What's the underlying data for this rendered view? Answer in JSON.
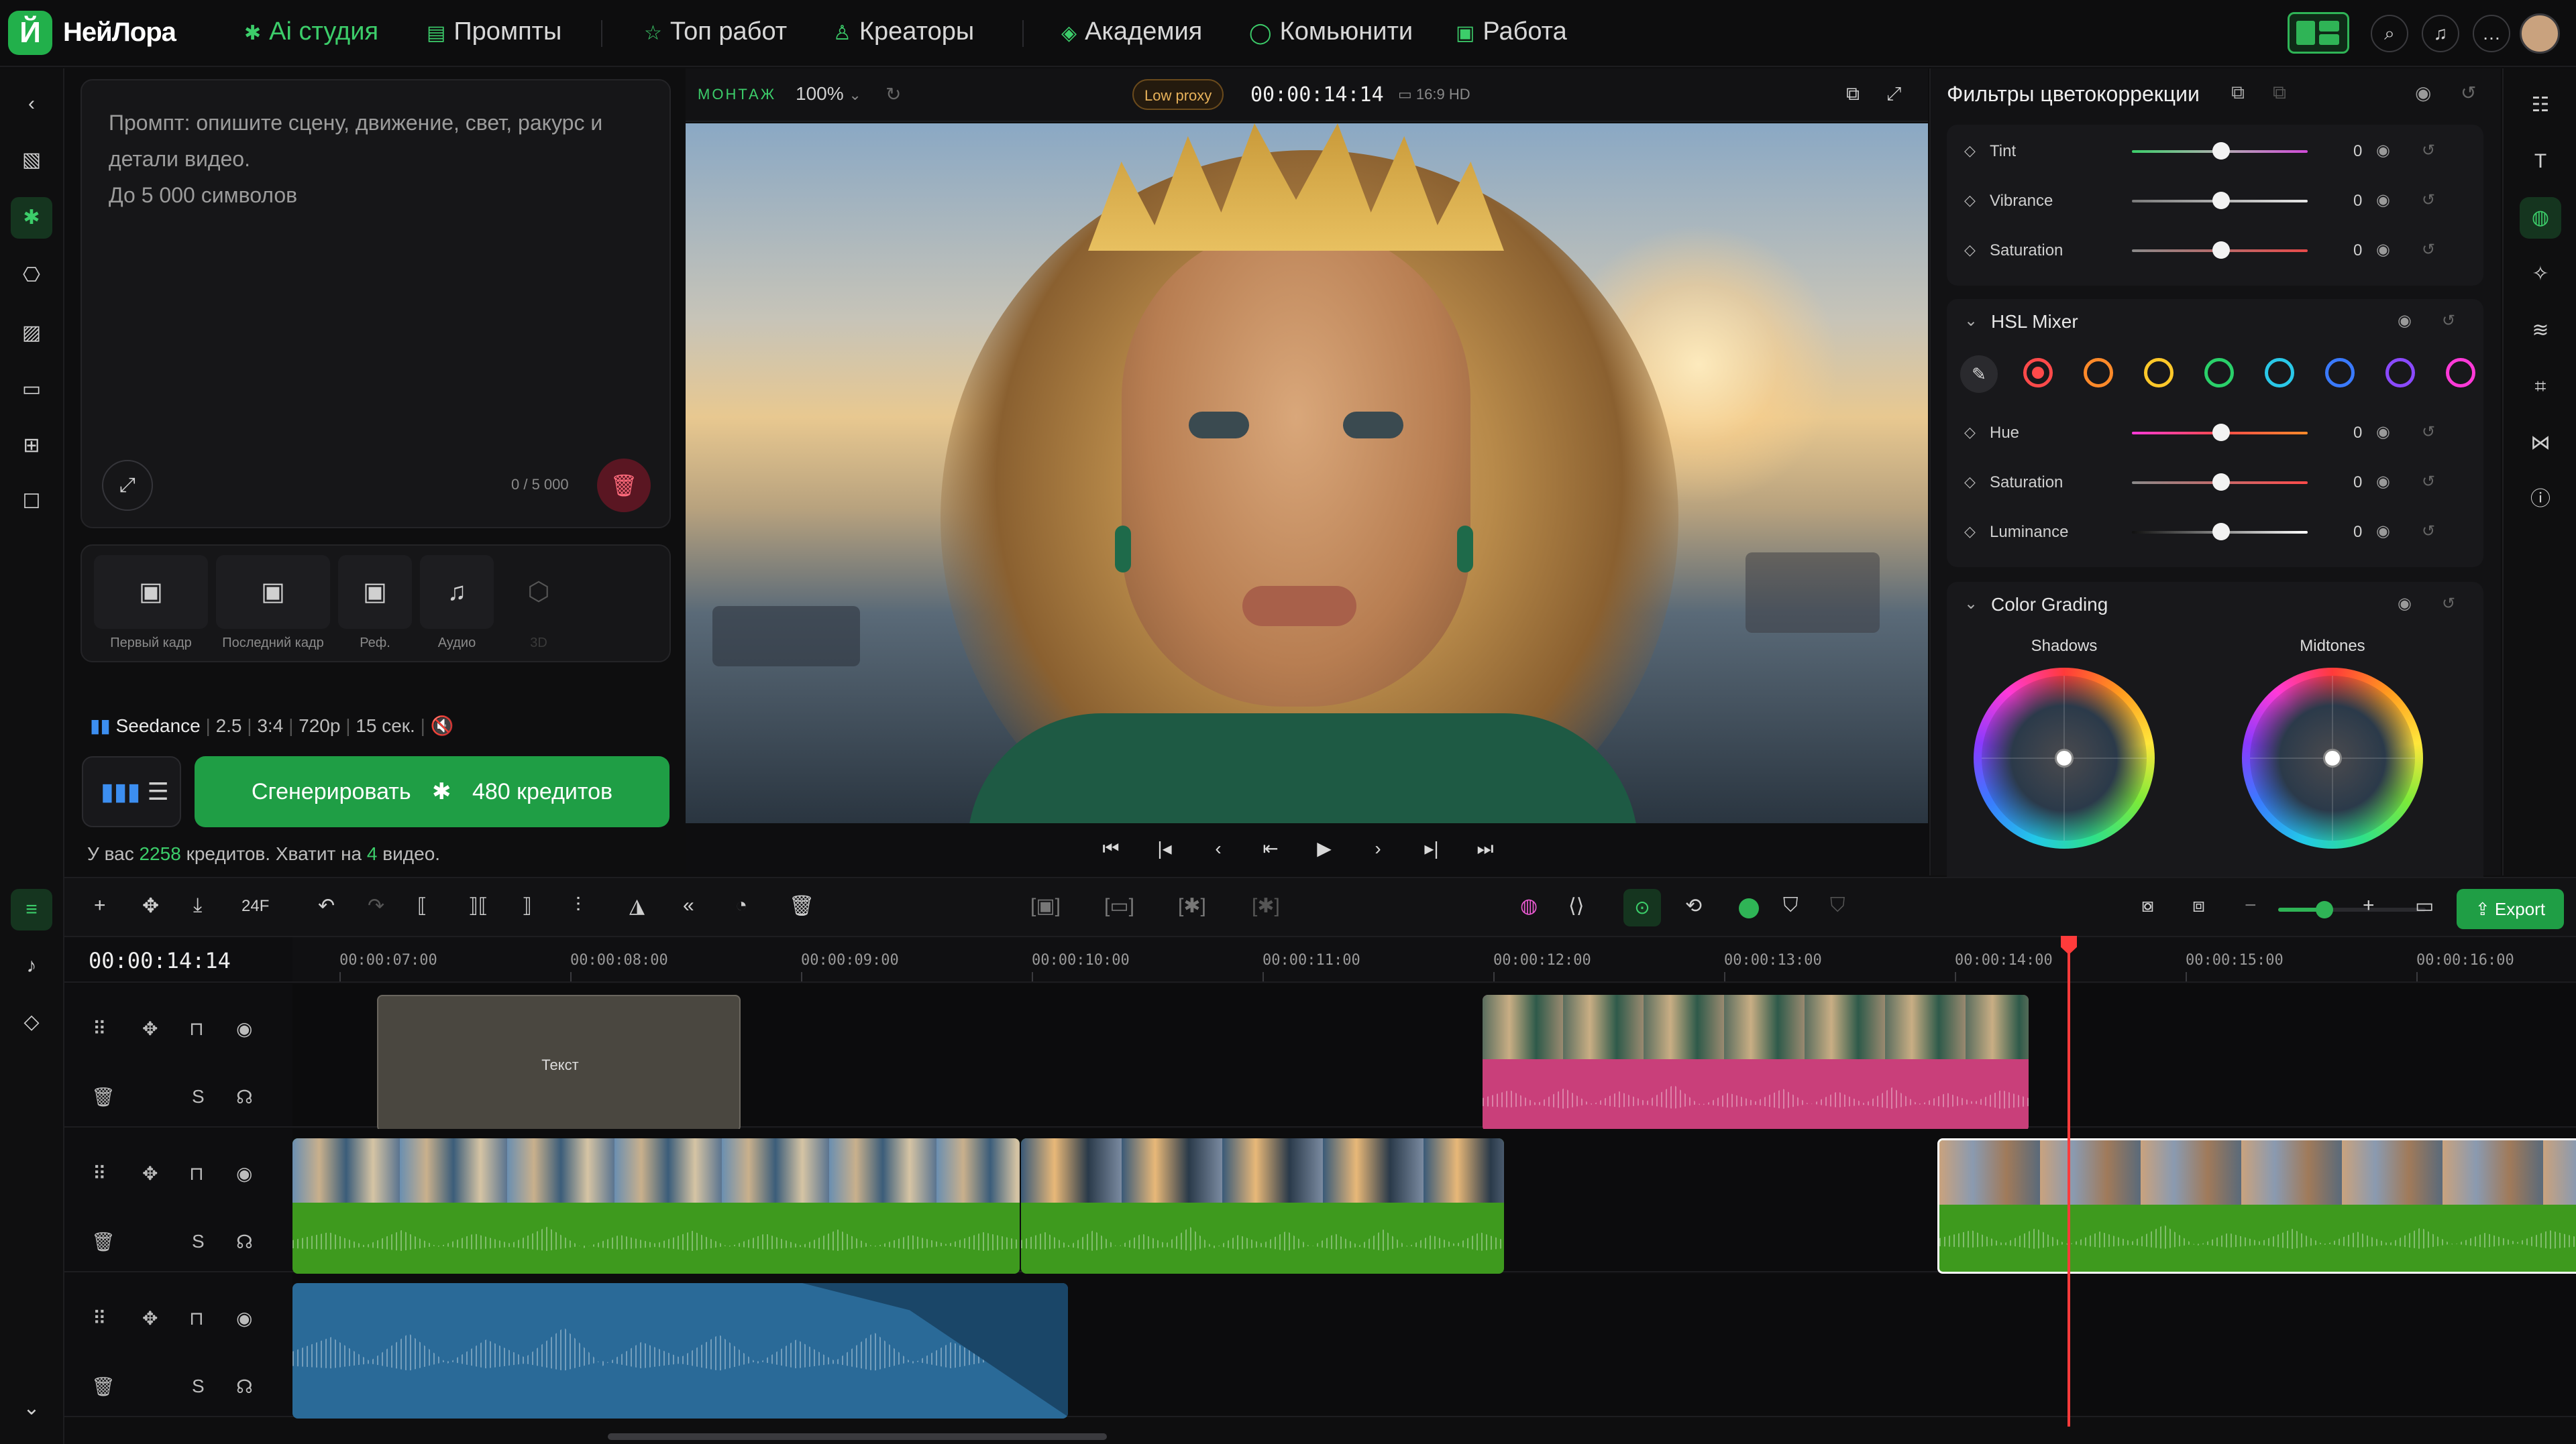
{
  "app": {
    "name": "НейЛора",
    "logo_letter": "Й",
    "accent": "#2fb456"
  },
  "nav": [
    {
      "label": "Ai студия",
      "icon": "sparkle-icon",
      "active": true
    },
    {
      "label": "Промпты",
      "icon": "grid-icon",
      "active": false
    },
    {
      "label": "Топ работ",
      "icon": "star-icon",
      "active": false
    },
    {
      "label": "Креаторы",
      "icon": "user-icon",
      "active": false
    },
    {
      "label": "Академия",
      "icon": "graduation-icon",
      "active": false
    },
    {
      "label": "Комьюнити",
      "icon": "chat-icon",
      "active": false
    },
    {
      "label": "Работа",
      "icon": "briefcase-icon",
      "active": false
    }
  ],
  "prompt": {
    "placeholder": "Промпт: опишите сцену, движение, свет, ракурс и детали видео.",
    "limit_hint": "До 5 000 символов",
    "counter": "0 / 5 000"
  },
  "media_slots": [
    {
      "label": "Первый кадр",
      "icon": "image-add-icon"
    },
    {
      "label": "Последний кадр",
      "icon": "image-add-icon"
    },
    {
      "label": "Реф.",
      "icon": "image-add-icon"
    },
    {
      "label": "Аудио",
      "icon": "audio-icon"
    },
    {
      "label": "3D",
      "icon": "cube-icon"
    }
  ],
  "model": {
    "name": "Seedance",
    "version": "2.5",
    "ratio": "3:4",
    "resolution": "720p",
    "duration": "15 сек."
  },
  "generate": {
    "label": "Сгенерировать",
    "cost": "480 кредитов"
  },
  "credits": {
    "prefix": "У вас",
    "amount": "2258",
    "middle": "кредитов. Хватит на",
    "videos": "4",
    "suffix": "видео."
  },
  "preview": {
    "mode": "МОНТАЖ",
    "zoom": "100%",
    "proxy": "Low proxy",
    "timecode": "00:00:14:14",
    "aspect": "16:9 HD"
  },
  "color_panel": {
    "title": "Фильтры цветокоррекции",
    "basic_rows": [
      {
        "label": "Tint",
        "value": "0",
        "gradient": "linear-gradient(90deg,#3ccd6a,#b0b0b0,#d04ad8)"
      },
      {
        "label": "Vibrance",
        "value": "0",
        "gradient": "linear-gradient(90deg,#7a7a7a,#e6e6e6)"
      },
      {
        "label": "Saturation",
        "value": "0",
        "gradient": "linear-gradient(90deg,#8a8a8a,#e84a4a)"
      }
    ],
    "hsl_title": "HSL Mixer",
    "hsl_colors": [
      "#ff4a4a",
      "#ff8a2a",
      "#ffc82a",
      "#2ad06a",
      "#2ac8e8",
      "#3a7aff",
      "#8a4aff",
      "#ff3ad8"
    ],
    "hsl_rows": [
      {
        "label": "Hue",
        "value": "0",
        "gradient": "linear-gradient(90deg,#ff3ad8,#ff4a4a,#ff8a2a)"
      },
      {
        "label": "Saturation",
        "value": "0",
        "gradient": "linear-gradient(90deg,#8a8a8a,#ff4a4a)"
      },
      {
        "label": "Luminance",
        "value": "0",
        "gradient": "linear-gradient(90deg,#111,#ffffff)"
      }
    ],
    "grading_title": "Color Grading",
    "wheels": [
      "Shadows",
      "Midtones"
    ]
  },
  "timeline": {
    "timecode": "00:00:14:14",
    "fps": "24F",
    "export_label": "Export",
    "ruler": [
      "00:00:07:00",
      "00:00:08:00",
      "00:00:09:00",
      "00:00:10:00",
      "00:00:11:00",
      "00:00:12:00",
      "00:00:13:00",
      "00:00:14:00",
      "00:00:15:00",
      "00:00:16:00"
    ],
    "text_clip": "Текст",
    "solo": "S"
  }
}
